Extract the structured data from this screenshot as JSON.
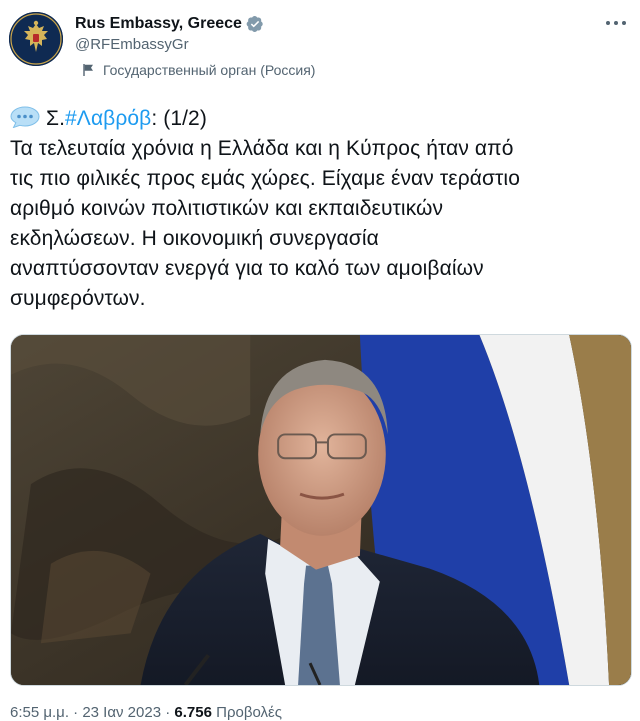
{
  "account": {
    "display_name": "Rus Embassy, Greece",
    "handle": "@RFEmbassyGr",
    "affiliation_label": "Государственный орган (Россия)"
  },
  "tweet": {
    "prefix": "Σ.",
    "hashtag": "#Λαβρόβ",
    "suffix": ": (1/2)",
    "lines": [
      "Τα τελευταία χρόνια η Ελλάδα και η Κύπρος ήταν από",
      "τις πιο φιλικές προς εμάς χώρες. Είχαμε έναν τεράστιο",
      "αριθμό κοινών πολιτιστικών και εκπαιδευτικών",
      "εκδηλώσεων. Η οικονομική συνεργασία",
      "αναπτύσσονταν ενεργά για το καλό των αμοιβαίων",
      "συμφερόντων."
    ]
  },
  "footer": {
    "time": "6:55 μ.μ.",
    "separator": "·",
    "date": "23 Ιαν 2023",
    "views_count": "6.756",
    "views_label": "Προβολές"
  },
  "icons": {
    "verified": "verified-badge-icon",
    "flag": "flag-icon",
    "speech": "speech-balloon-icon",
    "more": "more-options-icon"
  },
  "colors": {
    "accent": "#1d9bf0",
    "secondary_text": "#536471",
    "primary_text": "#0f1419",
    "verified_gray": "#829aab"
  }
}
